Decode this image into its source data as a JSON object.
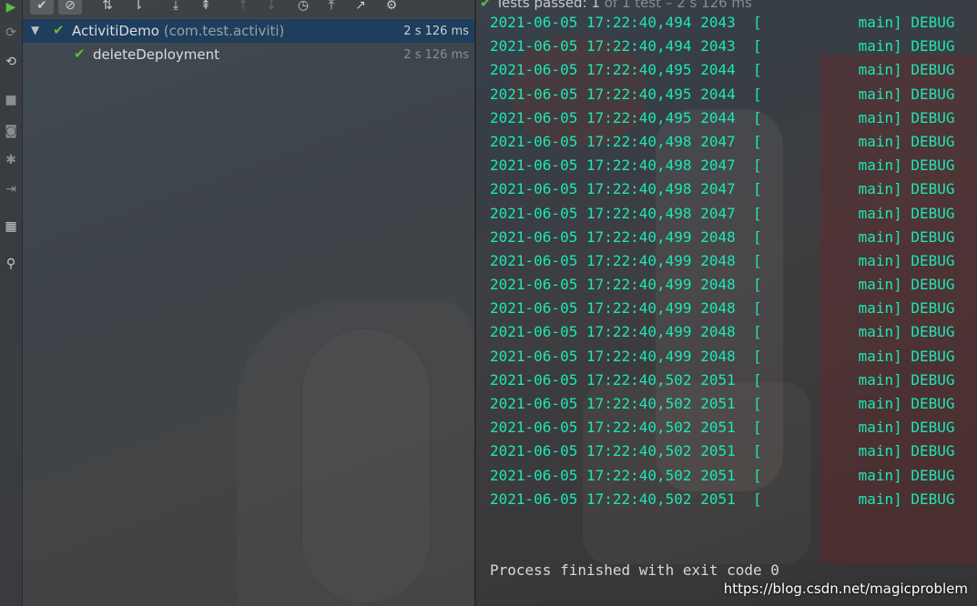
{
  "colors": {
    "log_text": "#1ee6b4",
    "check": "#5ebd3e",
    "selection": "#1f3d5c"
  },
  "toolbar": {
    "icons": [
      "run-icon",
      "show-passed-icon",
      "show-ignored-icon",
      "sort-alpha-icon",
      "sort-duration-icon",
      "expand-all-icon",
      "collapse-all-icon",
      "prev-failed-icon",
      "next-failed-icon",
      "history-icon",
      "import-icon",
      "export-icon",
      "settings-icon"
    ]
  },
  "status": {
    "label": "Tests passed:",
    "count": "1",
    "detail": "of 1 test – 2 s 126 ms"
  },
  "tree": {
    "suite": {
      "name": "ActivitiDemo",
      "package": "(com.test.activiti)",
      "duration": "2 s 126 ms"
    },
    "test": {
      "name": "deleteDeployment",
      "duration": "2 s 126 ms"
    }
  },
  "log": {
    "lines": [
      "2021-06-05 17:22:40,494 2043  [           main] DEBUG",
      "2021-06-05 17:22:40,494 2043  [           main] DEBUG",
      "2021-06-05 17:22:40,495 2044  [           main] DEBUG",
      "2021-06-05 17:22:40,495 2044  [           main] DEBUG",
      "2021-06-05 17:22:40,495 2044  [           main] DEBUG",
      "2021-06-05 17:22:40,498 2047  [           main] DEBUG",
      "2021-06-05 17:22:40,498 2047  [           main] DEBUG",
      "2021-06-05 17:22:40,498 2047  [           main] DEBUG",
      "2021-06-05 17:22:40,498 2047  [           main] DEBUG",
      "2021-06-05 17:22:40,499 2048  [           main] DEBUG",
      "2021-06-05 17:22:40,499 2048  [           main] DEBUG",
      "2021-06-05 17:22:40,499 2048  [           main] DEBUG",
      "2021-06-05 17:22:40,499 2048  [           main] DEBUG",
      "2021-06-05 17:22:40,499 2048  [           main] DEBUG",
      "2021-06-05 17:22:40,499 2048  [           main] DEBUG",
      "2021-06-05 17:22:40,502 2051  [           main] DEBUG",
      "2021-06-05 17:22:40,502 2051  [           main] DEBUG",
      "2021-06-05 17:22:40,502 2051  [           main] DEBUG",
      "2021-06-05 17:22:40,502 2051  [           main] DEBUG",
      "2021-06-05 17:22:40,502 2051  [           main] DEBUG",
      "2021-06-05 17:22:40,502 2051  [           main] DEBUG"
    ],
    "exit_message": "Process finished with exit code 0"
  },
  "watermark": "https://blog.csdn.net/magicproblem"
}
